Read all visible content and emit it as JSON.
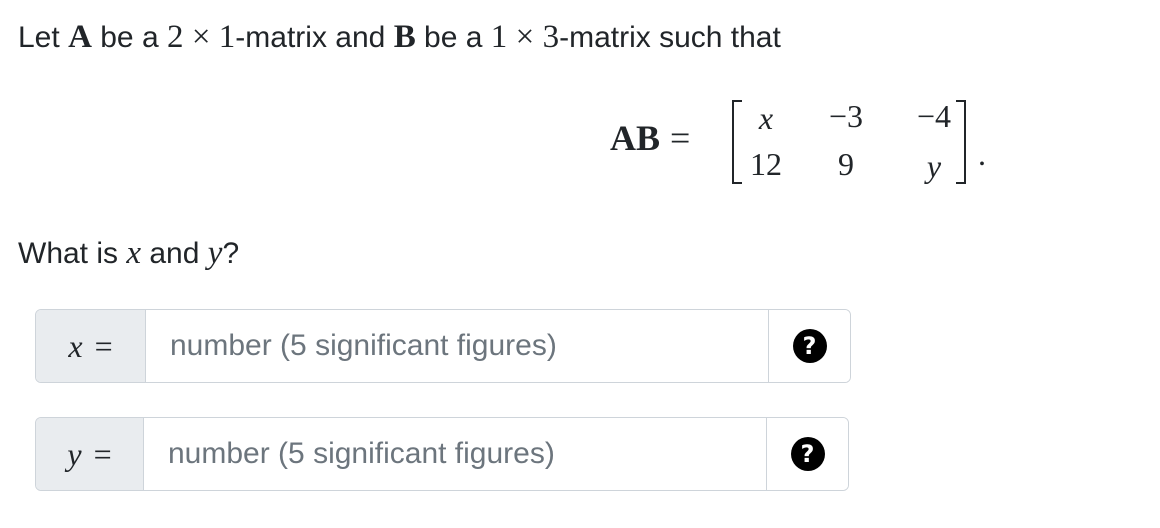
{
  "question": {
    "line1": {
      "let": "Let",
      "A": "A",
      "be_a_1": "be a",
      "dim_a_rows": "2",
      "times_1": "×",
      "dim_a_cols": "1",
      "matrix_and": "-matrix and",
      "B": "B",
      "be_a_2": "be a",
      "dim_b_rows": "1",
      "times_2": "×",
      "dim_b_cols": "3",
      "matrix_such_that": "-matrix such that"
    },
    "equation": {
      "lhs": "AB",
      "equals": "=",
      "matrix": [
        [
          "x",
          "−3",
          "−4"
        ],
        [
          "12",
          "9",
          "y"
        ]
      ],
      "period": "."
    },
    "line2": {
      "what_is": "What is",
      "x": "x",
      "and": "and",
      "y": "y",
      "qmark": "?"
    }
  },
  "answers": [
    {
      "variable": "x",
      "equals": "=",
      "value": "",
      "placeholder": "number (5 significant figures)",
      "help_icon": "question-circle-icon"
    },
    {
      "variable": "y",
      "equals": "=",
      "value": "",
      "placeholder": "number (5 significant figures)",
      "help_icon": "question-circle-icon"
    }
  ]
}
